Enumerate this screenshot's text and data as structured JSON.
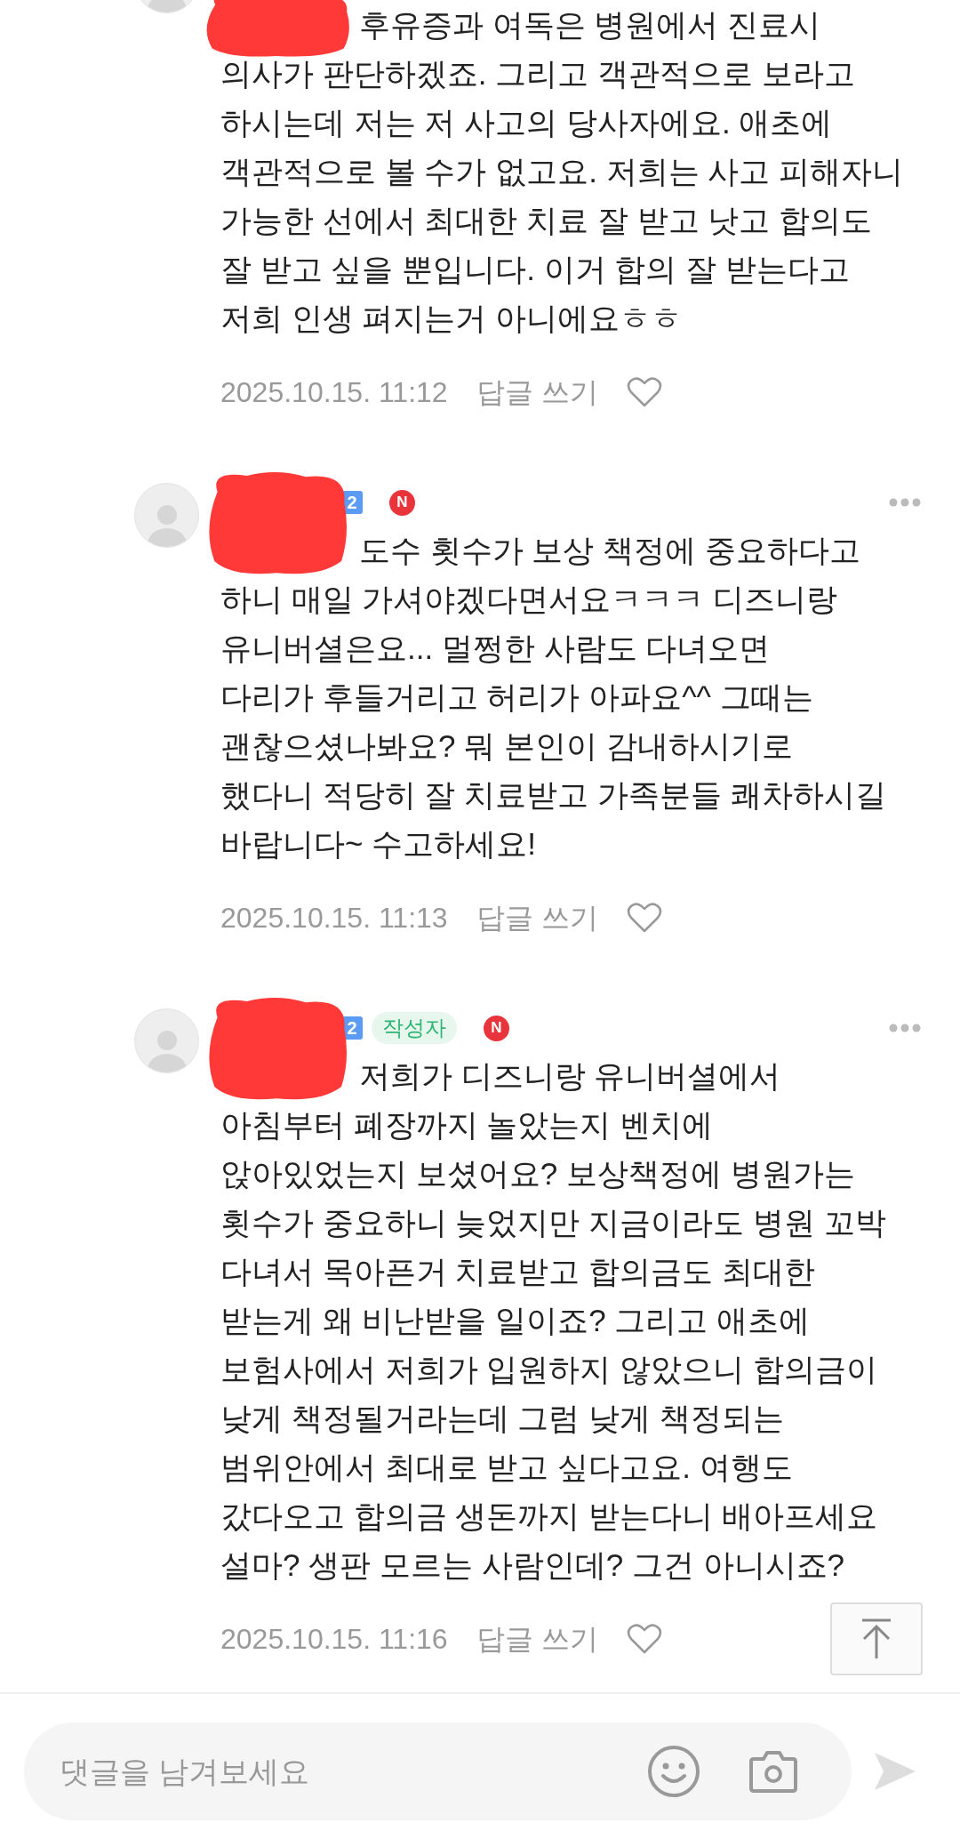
{
  "comments": [
    {
      "lines": [
        "후유증과 여독은 병원에서 진료시",
        "의사가 판단하겠죠. 그리고 객관적으로 보라고",
        "하시는데 저는 저 사고의 당사자에요. 애초에",
        "객관적으로 볼 수가 없고요. 저희는 사고 피해자니",
        "가능한 선에서 최대한 치료 잘 받고 낫고 합의도",
        "잘 받고 싶을 뿐입니다. 이거 합의 잘 받는다고",
        "저희 인생 펴지는거 아니에요ㅎㅎ"
      ],
      "timestamp": "2025.10.15. 11:12",
      "reply": "답글 쓰기",
      "liked": false
    },
    {
      "badges": [
        {
          "kind": "level",
          "text": "2"
        },
        {
          "kind": "new",
          "text": "N"
        }
      ],
      "lines": [
        "도수 횟수가 보상 책정에 중요하다고",
        "하니 매일 가셔야겠다면서요ㅋㅋㅋ 디즈니랑",
        "유니버셜은요... 멀쩡한 사람도 다녀오면",
        "다리가 후들거리고 허리가 아파요^^ 그때는",
        "괜찮으셨나봐요? 뭐 본인이 감내하시기로",
        "했다니 적당히 잘 치료받고 가족분들 쾌차하시길",
        "바랍니다~ 수고하세요!"
      ],
      "timestamp": "2025.10.15. 11:13",
      "reply": "답글 쓰기",
      "liked": false
    },
    {
      "badges": [
        {
          "kind": "level",
          "text": "2"
        },
        {
          "kind": "author",
          "text": "작성자"
        },
        {
          "kind": "new",
          "text": "N"
        }
      ],
      "lines": [
        "저희가 디즈니랑 유니버셜에서",
        "아침부터 폐장까지 놀았는지 벤치에",
        "앉아있었는지 보셨어요? 보상책정에 병원가는",
        "횟수가 중요하니 늦었지만 지금이라도 병원 꼬박",
        "다녀서 목아픈거 치료받고 합의금도 최대한",
        "받는게 왜 비난받을 일이죠? 그리고 애초에",
        "보험사에서 저희가 입원하지 않았으니 합의금이",
        "낮게 책정될거라는데 그럼 낮게 책정되는",
        "범위안에서 최대로 받고 싶다고요. 여행도",
        "갔다오고 합의금 생돈까지 받는다니 배아프세요",
        "설마? 생판 모르는 사람인데? 그건 아니시죠?"
      ],
      "timestamp": "2025.10.15. 11:16",
      "reply": "답글 쓰기",
      "liked": false
    }
  ],
  "composer": {
    "placeholder": "댓글을 남겨보세요"
  }
}
